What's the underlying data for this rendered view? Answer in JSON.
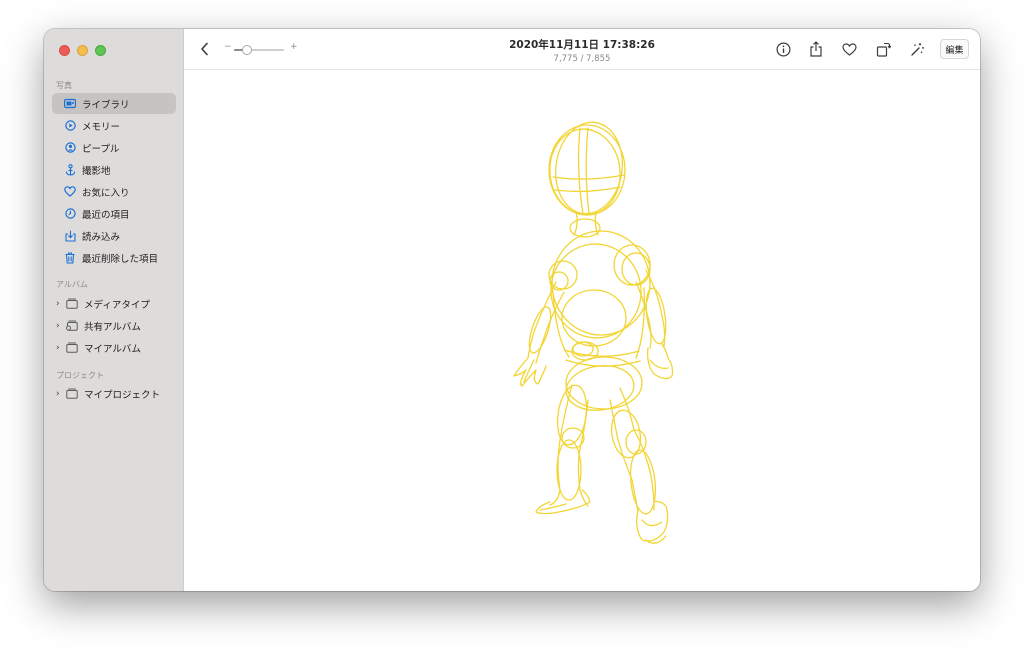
{
  "sidebar": {
    "sections": {
      "library": "写真",
      "albums": "アルバム",
      "projects": "プロジェクト"
    },
    "items": [
      {
        "label": "ライブラリ",
        "icon": "photos-library-icon",
        "active": true
      },
      {
        "label": "メモリー",
        "icon": "memories-icon"
      },
      {
        "label": "ピープル",
        "icon": "people-icon"
      },
      {
        "label": "撮影地",
        "icon": "places-icon"
      },
      {
        "label": "お気に入り",
        "icon": "heart-icon"
      },
      {
        "label": "最近の項目",
        "icon": "clock-icon"
      },
      {
        "label": "読み込み",
        "icon": "import-icon"
      },
      {
        "label": "最近削除した項目",
        "icon": "trash-icon"
      }
    ],
    "albums": [
      {
        "label": "メディアタイプ",
        "icon": "folder-icon"
      },
      {
        "label": "共有アルバム",
        "icon": "shared-album-icon"
      },
      {
        "label": "マイアルバム",
        "icon": "folder-icon"
      }
    ],
    "projects": [
      {
        "label": "マイプロジェクト",
        "icon": "folder-icon"
      }
    ]
  },
  "toolbar": {
    "title": "2020年11月11日 17:38:26",
    "subtitle": "7,775 / 7,855",
    "zoom_minus": "−",
    "zoom_plus": "+",
    "zoom_level": 0.25,
    "edit_label": "編集"
  },
  "theme": {
    "accent": "#1a6ed8",
    "sketch": "#f2d32a",
    "sidebar_bg": "#dedcda"
  }
}
